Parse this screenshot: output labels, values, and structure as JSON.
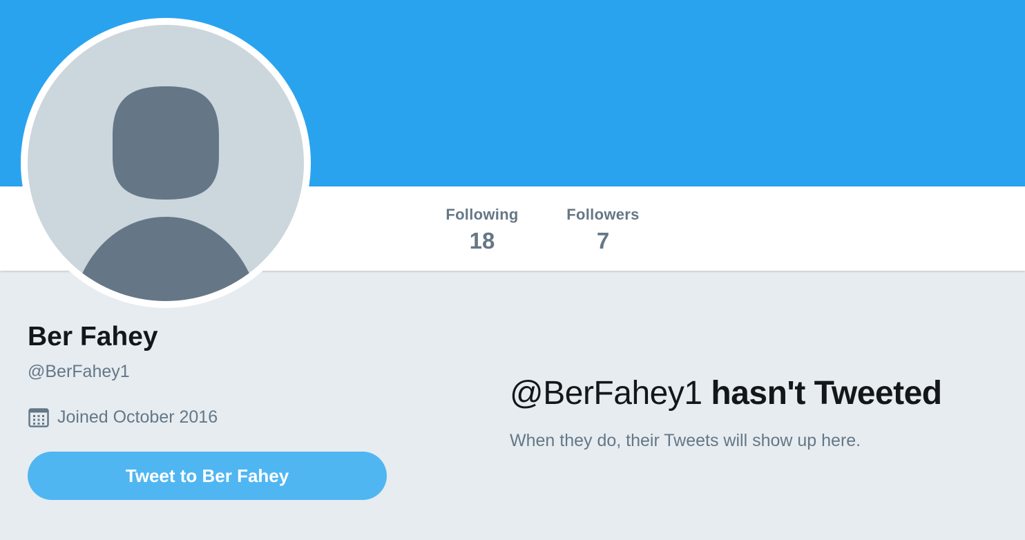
{
  "colors": {
    "banner": "#2aa3ef",
    "background": "#e6ecf0",
    "button": "#50b6f2",
    "avatar_bg": "#ccd6dd",
    "avatar_figure": "#657786"
  },
  "profile": {
    "name": "Ber Fahey",
    "handle": "@BerFahey1",
    "joined": "Joined October 2016",
    "avatar_icon": "default-avatar-icon",
    "calendar_icon": "calendar-icon"
  },
  "stats": {
    "following_label": "Following",
    "following_value": "18",
    "followers_label": "Followers",
    "followers_value": "7"
  },
  "tweet_button": {
    "label": "Tweet to Ber Fahey"
  },
  "empty_state": {
    "handle": "@BerFahey1",
    "title_rest": "hasn't Tweeted",
    "subtitle": "When they do, their Tweets will show up here."
  }
}
